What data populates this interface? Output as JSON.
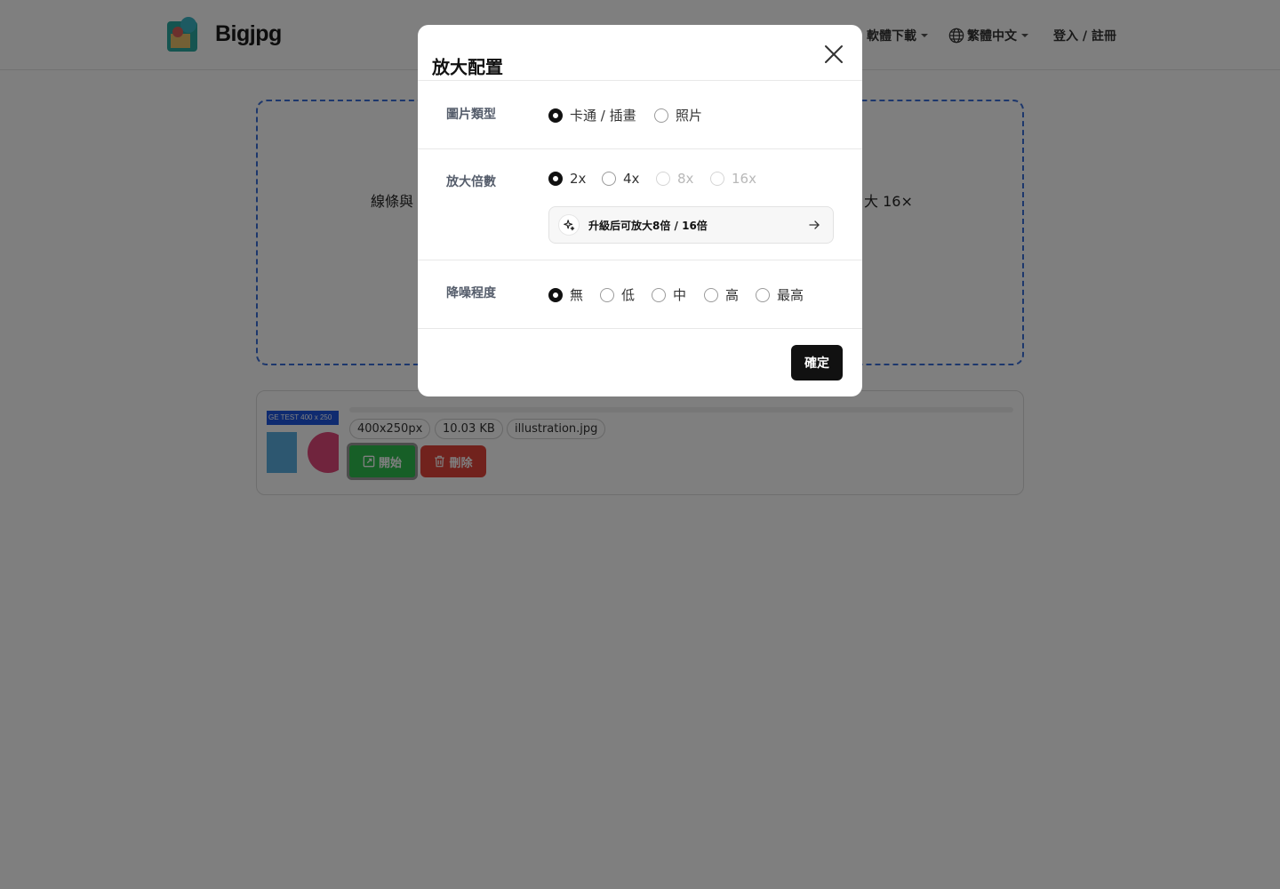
{
  "header": {
    "logo_text": "Bigjpg",
    "nav": {
      "download_label": "軟體下載",
      "language_label": "繁體中文",
      "login_label": "登入 / 註冊"
    }
  },
  "dropzone": {
    "text_left": "線條與",
    "text_right": "大 16×"
  },
  "file": {
    "thumb_caption": "GE TEST 400 x 250",
    "dimensions": "400x250px",
    "size": "10.03 KB",
    "name": "illustration.jpg",
    "start_label": "開始",
    "delete_label": "刪除"
  },
  "modal": {
    "title": "放大配置",
    "image_type": {
      "label": "圖片類型",
      "options": [
        {
          "label": "卡通 / 插畫",
          "selected": true,
          "disabled": false
        },
        {
          "label": "照片",
          "selected": false,
          "disabled": false
        }
      ]
    },
    "scale": {
      "label": "放大倍數",
      "options": [
        {
          "label": "2x",
          "selected": true,
          "disabled": false
        },
        {
          "label": "4x",
          "selected": false,
          "disabled": false
        },
        {
          "label": "8x",
          "selected": false,
          "disabled": true
        },
        {
          "label": "16x",
          "selected": false,
          "disabled": true
        }
      ],
      "upgrade_text": "升級后可放大8倍 / 16倍"
    },
    "noise": {
      "label": "降噪程度",
      "options": [
        {
          "label": "無",
          "selected": true,
          "disabled": false
        },
        {
          "label": "低",
          "selected": false,
          "disabled": false
        },
        {
          "label": "中",
          "selected": false,
          "disabled": false
        },
        {
          "label": "高",
          "selected": false,
          "disabled": false
        },
        {
          "label": "最高",
          "selected": false,
          "disabled": false
        }
      ]
    },
    "confirm_label": "確定"
  },
  "colors": {
    "accent_dark": "#111111",
    "start_green": "#2fbf4e",
    "delete_red": "#e2443a",
    "dropzone_blue": "#3b6fd8"
  }
}
